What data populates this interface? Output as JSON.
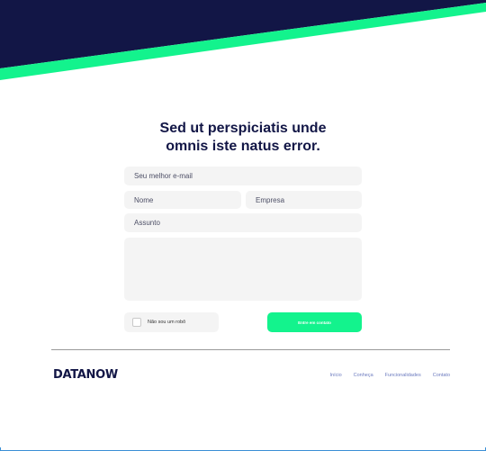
{
  "colors": {
    "navy": "#121646",
    "accent": "#13f38d",
    "field_bg": "#f4f4f4",
    "link": "#6c7bbf"
  },
  "heading": {
    "line1": "Sed ut perspiciatis unde",
    "line2": "omnis iste natus error."
  },
  "form": {
    "email_placeholder": "Seu melhor e-mail",
    "name_placeholder": "Nome",
    "company_placeholder": "Empresa",
    "subject_placeholder": "Assunto",
    "message_placeholder": "",
    "captcha_label": "Não sou um robô",
    "submit_label": "Entre em contato"
  },
  "footer": {
    "logo": "DATANOW",
    "nav": [
      "Início",
      "Conheça",
      "Funcionalidades",
      "Contato"
    ]
  }
}
